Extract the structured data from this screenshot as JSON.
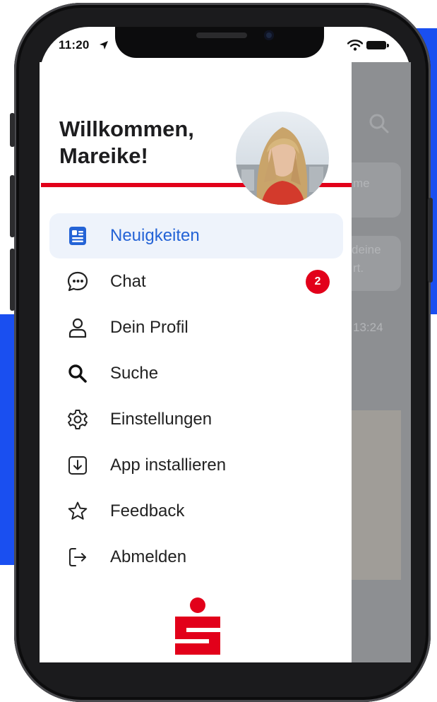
{
  "status_bar": {
    "time": "11:20"
  },
  "drawer": {
    "welcome_line1": "Willkommen,",
    "welcome_line2": "Mareike!",
    "menu": [
      {
        "label": "Neuigkeiten",
        "icon": "news-icon",
        "active": true
      },
      {
        "label": "Chat",
        "icon": "chat-icon",
        "badge": "2"
      },
      {
        "label": "Dein Profil",
        "icon": "profile-icon"
      },
      {
        "label": "Suche",
        "icon": "search-icon"
      },
      {
        "label": "Einstellungen",
        "icon": "gear-icon"
      },
      {
        "label": "App installieren",
        "icon": "download-icon"
      },
      {
        "label": "Feedback",
        "icon": "star-icon"
      },
      {
        "label": "Abmelden",
        "icon": "logout-icon"
      }
    ]
  },
  "underlay": {
    "card1_text": "me",
    "card2_line1": "deine",
    "card2_line2": "rt.",
    "timestamp": "13:24"
  },
  "colors": {
    "accent_red": "#e2001a",
    "active_blue": "#2463d6",
    "background_blue": "#1a4ff0"
  }
}
